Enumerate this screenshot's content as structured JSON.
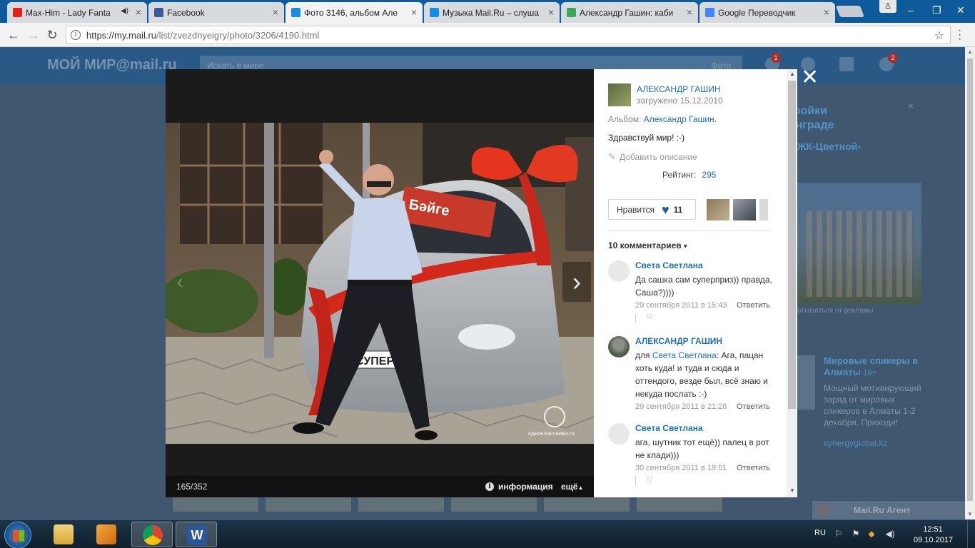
{
  "browser": {
    "tabs": [
      {
        "title": "Max-Him - Lady Fanta",
        "favicon_color": "#e62117",
        "audio": true
      },
      {
        "title": "Facebook",
        "favicon_color": "#3b5998"
      },
      {
        "title": "Фото 3146, альбом Але",
        "favicon_color": "#168de2",
        "active": true
      },
      {
        "title": "Музыка Mail.Ru – слуша",
        "favicon_color": "#168de2"
      },
      {
        "title": "Александр Гашин: каби",
        "favicon_color": "#3aa757"
      },
      {
        "title": "Google Переводчик",
        "favicon_color": "#4285f4"
      }
    ],
    "url_host": "https://my.mail.ru",
    "url_path": "/list/zvezdnyeigry/photo/3206/4190.html"
  },
  "page_bg": {
    "logo": "МОЙ МИР@mail.ru",
    "search_placeholder": "Искать в мире",
    "search_scope": "Фото",
    "badge1": "1",
    "badge2": "2",
    "ad_title": "стройки\nнинграде",
    "ad_link": ".ru/ЖК-Цветной-\nар",
    "ad_caption": "отказаться от рекламы",
    "ad2_title": "Мировые спикеры в Алматы",
    "ad2_age": "16+",
    "ad2_text": "Мощный мотивирующий заряд от мировых спикеров в Алматы 1-2 декабря. Приходи!",
    "ad2_link": "synergyglobal.kz",
    "agent": "Mail.Ru Агент"
  },
  "viewer": {
    "counter": "165/352",
    "info_label": "информация",
    "more_label": "ещё",
    "watermark": "одноклассники.ru"
  },
  "panel": {
    "author": "АЛЕКСАНДР ГАШИН",
    "uploaded": "загружено 15.12.2010",
    "album_label": "Альбом:",
    "album_name": "Александр Гашин.",
    "caption": "Здравствуй мир! :-)",
    "add_description": "Добавить описание",
    "rating_label": "Рейтинг:",
    "rating_value": "295",
    "like_label": "Нравится",
    "like_count": "11",
    "comments_title": "10 комментариев",
    "comments": [
      {
        "name": "Света Светлана",
        "text": "Да сашка сам суперприз)) правда, Саша?))))",
        "date": "29 сентября 2011 в 15:43",
        "reply": "Ответить"
      },
      {
        "name": "АЛЕКСАНДР ГАШИН",
        "prefix": "для",
        "mention": "Света Светлана",
        "text": ": Ага, пацан хоть куда! и туда и сюда и оттендого, везде был, всё знаю и некуда послать :-)",
        "date": "29 сентября 2011 в 21:28",
        "reply": "Ответить"
      },
      {
        "name": "Света Светлана",
        "text": "ага, шутник тот ещё)) палец в рот не клади)))",
        "date": "30 сентября 2011 в 19:01",
        "reply": "Ответить"
      }
    ]
  },
  "taskbar": {
    "lang": "RU",
    "time": "12:51",
    "date": "09.10.2017"
  }
}
